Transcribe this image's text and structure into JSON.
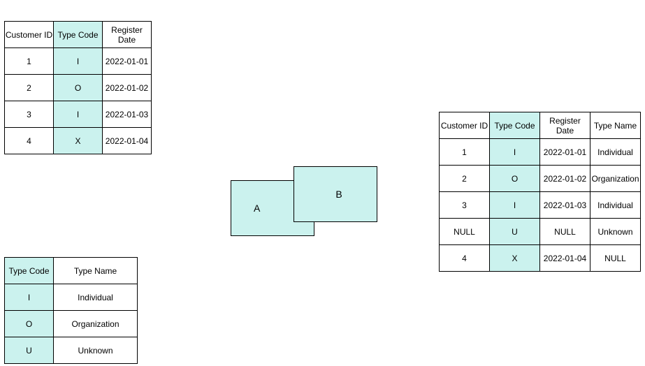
{
  "tableA": {
    "headers": [
      "Customer ID",
      "Type Code",
      "Register Date"
    ],
    "rows": [
      {
        "cid": "1",
        "code": "I",
        "date": "2022-01-01"
      },
      {
        "cid": "2",
        "code": "O",
        "date": "2022-01-02"
      },
      {
        "cid": "3",
        "code": "I",
        "date": "2022-01-03"
      },
      {
        "cid": "4",
        "code": "X",
        "date": "2022-01-04"
      }
    ]
  },
  "tableB": {
    "headers": [
      "Type Code",
      "Type Name"
    ],
    "rows": [
      {
        "code": "I",
        "name": "Individual"
      },
      {
        "code": "O",
        "name": "Organization"
      },
      {
        "code": "U",
        "name": "Unknown"
      }
    ]
  },
  "result": {
    "headers": [
      "Customer ID",
      "Type Code",
      "Register Date",
      "Type Name"
    ],
    "rows": [
      {
        "cid": "1",
        "code": "I",
        "date": "2022-01-01",
        "name": "Individual"
      },
      {
        "cid": "2",
        "code": "O",
        "date": "2022-01-02",
        "name": "Organization"
      },
      {
        "cid": "3",
        "code": "I",
        "date": "2022-01-03",
        "name": "Individual"
      },
      {
        "cid": "NULL",
        "code": "U",
        "date": "NULL",
        "name": "Unknown"
      },
      {
        "cid": "4",
        "code": "X",
        "date": "2022-01-04",
        "name": "NULL"
      }
    ]
  },
  "venn": {
    "a": "A",
    "b": "B"
  }
}
